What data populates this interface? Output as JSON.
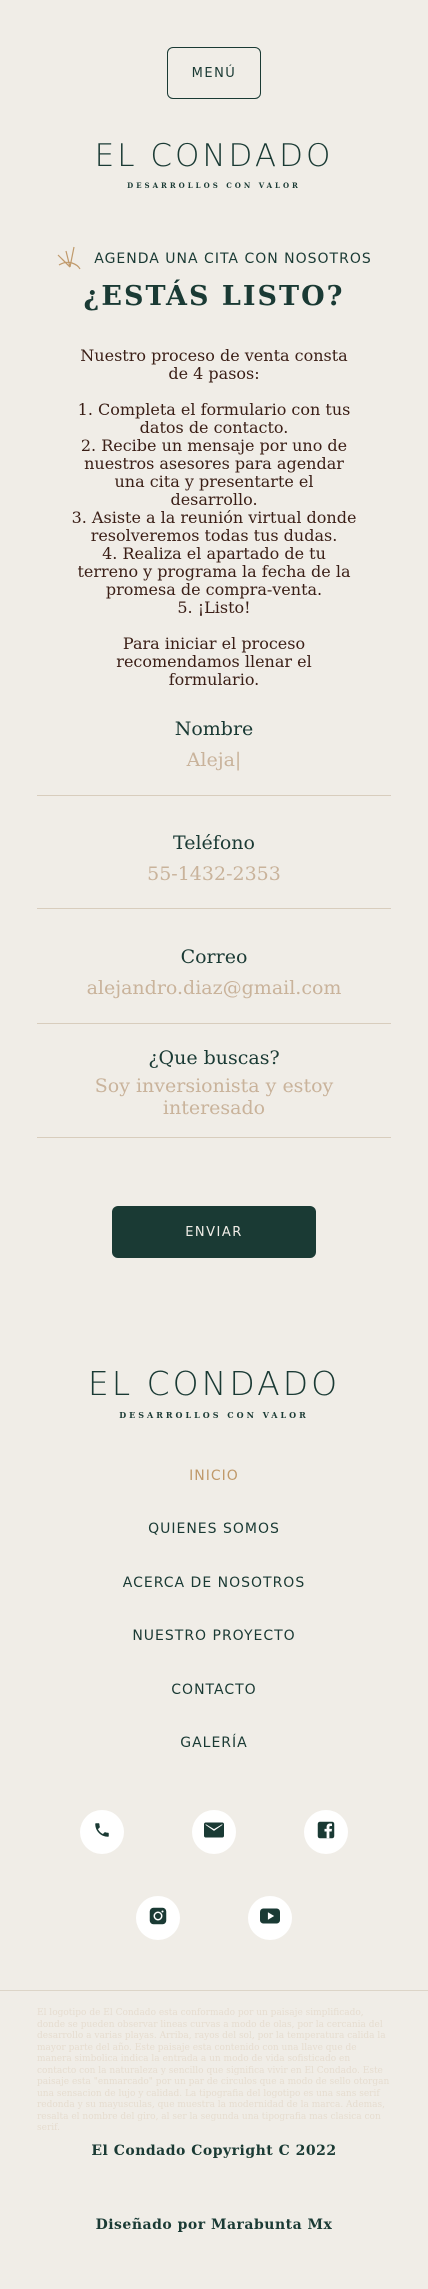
{
  "header": {
    "menu_label": "MENÚ"
  },
  "logo": {
    "title": "EL CONDADO",
    "subtitle": "DESARROLLOS CON VALOR"
  },
  "intro": {
    "agenda": "AGENDA UNA CITA CON NOSOTROS",
    "headline": "¿ESTÁS LISTO?",
    "process_intro": "Nuestro proceso de venta consta de 4 pasos:",
    "steps": [
      "1. Completa el formulario con tus datos de contacto.",
      "2. Recibe un mensaje por uno de nuestros asesores para agendar una cita y presentarte el desarrollo.",
      "3. Asiste a la reunión virtual donde resolveremos todas tus dudas.",
      "4. Realiza el apartado de tu terreno y programa la fecha de la promesa de compra-venta.",
      "5. ¡Listo!"
    ],
    "closing": "Para iniciar el proceso recomendamos llenar el formulario."
  },
  "form": {
    "name_label": "Nombre",
    "name_value": "Aleja|",
    "phone_label": "Teléfono",
    "phone_placeholder": "55-1432-2353",
    "email_label": "Correo",
    "email_placeholder": "alejandro.diaz@gmail.com",
    "seek_label": "¿Que buscas?",
    "seek_placeholder": "Soy inversionista y estoy interesado",
    "submit_label": "ENVIAR"
  },
  "footer": {
    "logo_title": "EL CONDADO",
    "logo_subtitle": "DESARROLLOS CON VALOR",
    "nav": [
      "INICIO",
      "QUIENES SOMOS",
      "ACERCA DE NOSOTROS",
      "NUESTRO PROYECTO",
      "CONTACTO",
      "GALERÍA"
    ],
    "social_icons": [
      "phone-icon",
      "mail-icon",
      "facebook-icon",
      "instagram-icon",
      "youtube-icon"
    ],
    "description": "El logotipo de El Condado esta conformado por un paisaje simplificado, donde se pueden observar lineas curvas a modo de olas, por la cercania del desarrollo a varias playas. Arriba, rayos del sol, por la temperatura calida la mayor parte del año. Este paisaje esta contenido con una llave que de manera simbolica indica la entrada a un modo de vida sofisticado en contacto con la naturaleza y sencillo que significa vivir en El Condado. Este paisaje esta \"enmarcado\" por un par de circulos que a modo de sello otorgan una sensacion de lujo y calidad. La tipografia del logotipo es una sans serif redonda y su mayusculas, que muestra la modernidad de la marca. Ademas, resalta el nombre del giro, al ser la segunda una tipografia mas clasica con serif.",
    "copyright": "El Condado Copyright C 2022",
    "credits": "Diseñado por Marabunta Mx"
  },
  "colors": {
    "primary": "#1a3a34",
    "accent": "#c09a6b",
    "background": "#f0ede7",
    "text_body": "#3a1e16",
    "placeholder": "#c9b39b"
  }
}
